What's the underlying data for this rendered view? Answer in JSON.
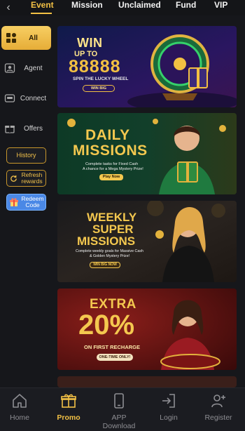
{
  "top_tabs": {
    "back_label": "‹",
    "items": [
      {
        "label": "Event",
        "active": true
      },
      {
        "label": "Mission",
        "active": false
      },
      {
        "label": "Unclaimed",
        "active": false
      },
      {
        "label": "Fund",
        "active": false
      },
      {
        "label": "VIP",
        "active": false
      }
    ]
  },
  "sidebar": {
    "categories": [
      {
        "label": "All",
        "icon": "grid-icon",
        "active": true
      },
      {
        "label": "Agent",
        "icon": "agent-icon",
        "active": false
      },
      {
        "label": "Connect",
        "icon": "connect-icon",
        "active": false
      },
      {
        "label": "Offers",
        "icon": "gift-icon",
        "active": false
      }
    ],
    "history_label": "History",
    "refresh_label": "Refresh rewards",
    "redeem_label": "Redeem Code"
  },
  "banners": [
    {
      "name": "lucky-wheel",
      "title_line1": "WIN",
      "title_line2": "UP TO",
      "amount": "88888",
      "subtitle": "SPIN THE LUCKY WHEEL",
      "button": "WIN BIG"
    },
    {
      "name": "daily-missions",
      "title_line1": "DAILY",
      "title_line2": "MISSIONS",
      "desc_line1": "Complete tasks for Fixed Cash",
      "desc_line2": "A chance for a Mega Mystery Prize!",
      "button": "Play Now"
    },
    {
      "name": "weekly-super-missions",
      "title_line1": "WEEKLY",
      "title_line2": "SUPER",
      "title_line3": "MISSIONS",
      "desc_line1": "Complete weekly goals for Massive Cash",
      "desc_line2": "& Golden Mystery Prize!",
      "button": "WIN BIG NOW"
    },
    {
      "name": "extra-recharge",
      "title_line1": "EXTRA",
      "percent": "20%",
      "subtitle": "ON FIRST RECHARGE",
      "button": "ONE-TIME ONLY!"
    }
  ],
  "bottom_nav": [
    {
      "label": "Home",
      "icon": "home-icon",
      "active": false
    },
    {
      "label": "Promo",
      "icon": "gift-icon",
      "active": true
    },
    {
      "label": "APP Download",
      "icon": "phone-icon",
      "active": false
    },
    {
      "label": "Login",
      "icon": "login-icon",
      "active": false
    },
    {
      "label": "Register",
      "icon": "add-user-icon",
      "active": false
    }
  ],
  "colors": {
    "accent": "#f3c145",
    "background": "#16171b",
    "redeem_blue": "#4a88e6"
  }
}
